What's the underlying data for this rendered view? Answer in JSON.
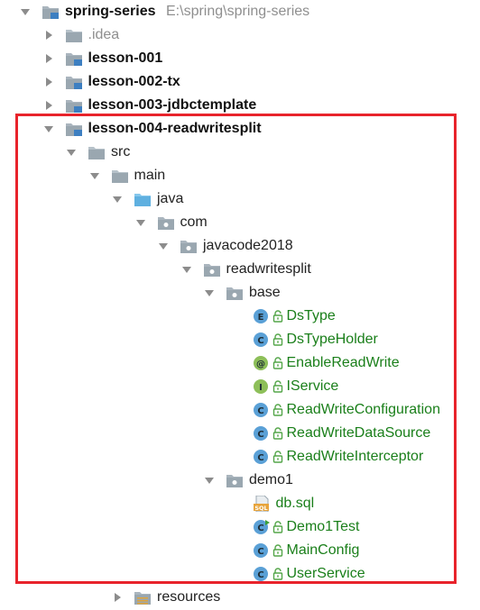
{
  "tree": [
    {
      "name": "spring-series",
      "path": "E:\\spring\\spring-series",
      "type": "module",
      "expanded": true,
      "style": "bold",
      "icon": "module-folder-icon"
    },
    {
      "name": ".idea",
      "type": "folder",
      "expanded": false,
      "style": "grey",
      "icon": "folder-icon"
    },
    {
      "name": "lesson-001",
      "type": "module",
      "expanded": false,
      "style": "bold",
      "icon": "module-folder-icon"
    },
    {
      "name": "lesson-002-tx",
      "type": "module",
      "expanded": false,
      "style": "bold",
      "icon": "module-folder-icon"
    },
    {
      "name": "lesson-003-jdbctemplate",
      "type": "module",
      "expanded": false,
      "style": "bold",
      "icon": "module-folder-icon"
    },
    {
      "name": "lesson-004-readwritesplit",
      "type": "module",
      "expanded": true,
      "style": "bold",
      "icon": "module-folder-icon"
    },
    {
      "name": "src",
      "type": "folder",
      "expanded": true,
      "style": "normal",
      "icon": "folder-icon"
    },
    {
      "name": "main",
      "type": "folder",
      "expanded": true,
      "style": "normal",
      "icon": "folder-icon"
    },
    {
      "name": "java",
      "type": "source-folder",
      "expanded": true,
      "style": "normal",
      "icon": "source-folder-icon"
    },
    {
      "name": "com",
      "type": "package",
      "expanded": true,
      "style": "normal",
      "icon": "package-icon"
    },
    {
      "name": "javacode2018",
      "type": "package",
      "expanded": true,
      "style": "normal",
      "icon": "package-icon"
    },
    {
      "name": "readwritesplit",
      "type": "package",
      "expanded": true,
      "style": "normal",
      "icon": "package-icon"
    },
    {
      "name": "base",
      "type": "package",
      "expanded": true,
      "style": "normal",
      "icon": "package-icon"
    },
    {
      "name": "DsType",
      "type": "enum",
      "style": "green",
      "icon": "enum-icon",
      "badge": "E"
    },
    {
      "name": "DsTypeHolder",
      "type": "class",
      "style": "green",
      "icon": "class-icon",
      "badge": "C"
    },
    {
      "name": "EnableReadWrite",
      "type": "annotation",
      "style": "green",
      "icon": "annotation-icon",
      "badge": "@"
    },
    {
      "name": "IService",
      "type": "interface",
      "style": "green",
      "icon": "interface-icon",
      "badge": "I"
    },
    {
      "name": "ReadWriteConfiguration",
      "type": "class",
      "style": "green",
      "icon": "class-icon",
      "badge": "C"
    },
    {
      "name": "ReadWriteDataSource",
      "type": "class",
      "style": "green",
      "icon": "class-icon",
      "badge": "C"
    },
    {
      "name": "ReadWriteInterceptor",
      "type": "class",
      "style": "green",
      "icon": "class-icon",
      "badge": "C"
    },
    {
      "name": "demo1",
      "type": "package",
      "expanded": true,
      "style": "normal",
      "icon": "package-icon"
    },
    {
      "name": "db.sql",
      "type": "sql",
      "style": "green",
      "icon": "sql-file-icon",
      "badge": "SQL"
    },
    {
      "name": "Demo1Test",
      "type": "test-class",
      "style": "green",
      "icon": "test-class-icon",
      "badge": "C"
    },
    {
      "name": "MainConfig",
      "type": "class",
      "style": "green",
      "icon": "class-icon",
      "badge": "C"
    },
    {
      "name": "UserService",
      "type": "class",
      "style": "green",
      "icon": "class-icon",
      "badge": "C"
    },
    {
      "name": "resources",
      "type": "resources",
      "expanded": false,
      "style": "normal",
      "icon": "resources-folder-icon"
    }
  ],
  "colors": {
    "highlight_border": "#e8232b",
    "file_green": "#1a7f1a",
    "class_blue": "#5aa0d6",
    "enum_blue": "#5aa0d6",
    "interface_green": "#8dbf59",
    "annotation_green": "#8dbf59",
    "folder_grey": "#9aa7b0",
    "source_folder_blue": "#5fb0e0",
    "module_blue": "#3d7fc1"
  }
}
